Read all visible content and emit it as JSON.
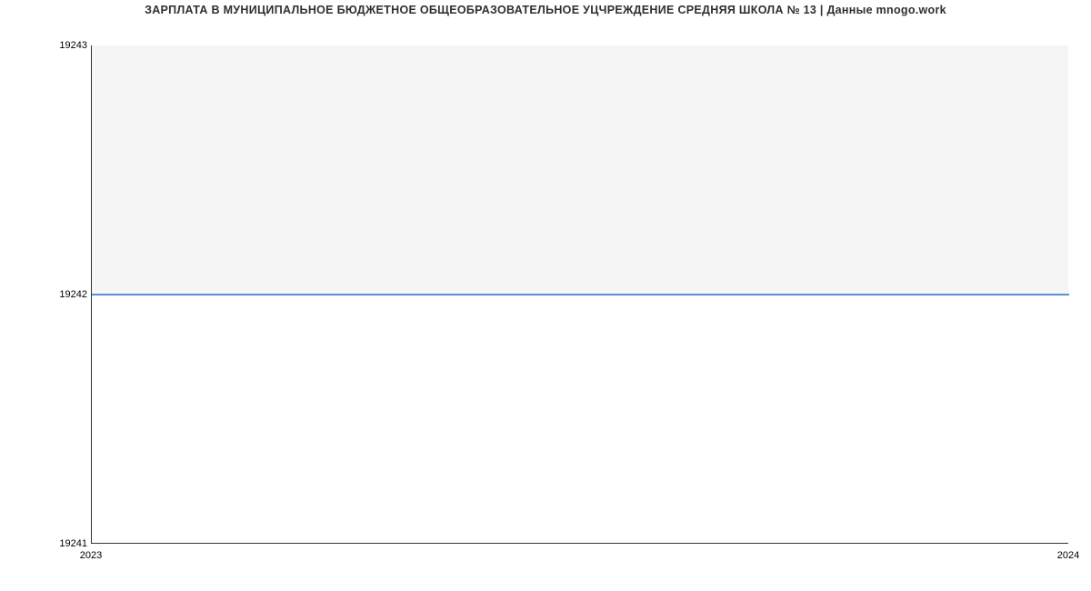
{
  "chart_data": {
    "type": "line",
    "title": "ЗАРПЛАТА В МУНИЦИПАЛЬНОЕ БЮДЖЕТНОЕ ОБЩЕОБРАЗОВАТЕЛЬНОЕ УЦЧРЕЖДЕНИЕ СРЕДНЯЯ ШКОЛА № 13 | Данные mnogo.work",
    "x": [
      2023,
      2024
    ],
    "values": [
      19242,
      19242
    ],
    "xlabel": "",
    "ylabel": "",
    "xlim": [
      2023,
      2024
    ],
    "ylim": [
      19241,
      19243
    ],
    "y_ticks": [
      19241,
      19242,
      19243
    ],
    "x_ticks": [
      2023,
      2024
    ],
    "line_color": "#5b8fd6",
    "plot_bg": "#f5f5f5"
  }
}
